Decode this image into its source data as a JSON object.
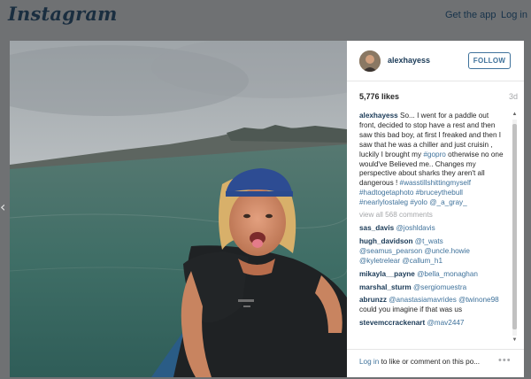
{
  "topbar": {
    "logo": "Instagram",
    "get_app": "Get the app",
    "login": "Log in"
  },
  "nav": {
    "prev_arrow": "‹"
  },
  "post": {
    "username": "alexhayess",
    "follow_label": "FOLLOW",
    "likes": "5,776 likes",
    "age": "3d",
    "caption": {
      "user": "alexhayess",
      "parts": [
        {
          "t": "text",
          "v": " So... I went for a paddle out front, decided to stop have a rest and then saw this bad boy, at first I freaked and then I saw that he was a chiller and just cruisin , luckily I brought my "
        },
        {
          "t": "tag",
          "v": "#gopro"
        },
        {
          "t": "text",
          "v": " otherwise no one would've Believed me.. Changes my perspective about sharks they aren't all dangerous ! "
        },
        {
          "t": "tag",
          "v": "#wasstillshittingmyself"
        },
        {
          "t": "text",
          "v": " "
        },
        {
          "t": "tag",
          "v": "#hadtogetaphoto"
        },
        {
          "t": "text",
          "v": " "
        },
        {
          "t": "tag",
          "v": "#bruceythebull"
        },
        {
          "t": "text",
          "v": " "
        },
        {
          "t": "tag",
          "v": "#nearlylostaleg"
        },
        {
          "t": "text",
          "v": " "
        },
        {
          "t": "tag",
          "v": "#yolo"
        },
        {
          "t": "text",
          "v": " "
        },
        {
          "t": "mention",
          "v": "@_a_gray_"
        }
      ]
    },
    "view_all": "view all 568 comments",
    "comments": [
      {
        "user": "sas_davis",
        "parts": [
          {
            "t": "mention",
            "v": "@joshldavis"
          }
        ]
      },
      {
        "user": "hugh_davidson",
        "parts": [
          {
            "t": "mention",
            "v": "@t_wats"
          },
          {
            "t": "text",
            "v": " "
          },
          {
            "t": "mention",
            "v": "@seamus_pearson"
          },
          {
            "t": "text",
            "v": " "
          },
          {
            "t": "mention",
            "v": "@uncle.howie"
          },
          {
            "t": "text",
            "v": " "
          },
          {
            "t": "mention",
            "v": "@kyletrelear"
          },
          {
            "t": "text",
            "v": " "
          },
          {
            "t": "mention",
            "v": "@callum_h1"
          }
        ]
      },
      {
        "user": "mikayla__payne",
        "parts": [
          {
            "t": "mention",
            "v": "@bella_monaghan"
          }
        ]
      },
      {
        "user": "marshal_sturm",
        "parts": [
          {
            "t": "mention",
            "v": "@sergiomuestra"
          }
        ]
      },
      {
        "user": "abrunzz",
        "parts": [
          {
            "t": "mention",
            "v": "@anastasiamavrides"
          },
          {
            "t": "text",
            "v": " "
          },
          {
            "t": "mention",
            "v": "@twinone98"
          },
          {
            "t": "text",
            "v": " could you imagine if that was us"
          }
        ]
      },
      {
        "user": "stevemccrackenart",
        "parts": [
          {
            "t": "mention",
            "v": "@mav2447"
          }
        ]
      }
    ],
    "scroll_position": 0.02,
    "scroll_visible_fraction": 0.95
  },
  "footer": {
    "login_link": "Log in",
    "login_rest": " to like or comment on this po...",
    "more": "•••"
  },
  "icons": {
    "more": "more-options-icon",
    "prev": "chevron-left-icon"
  }
}
